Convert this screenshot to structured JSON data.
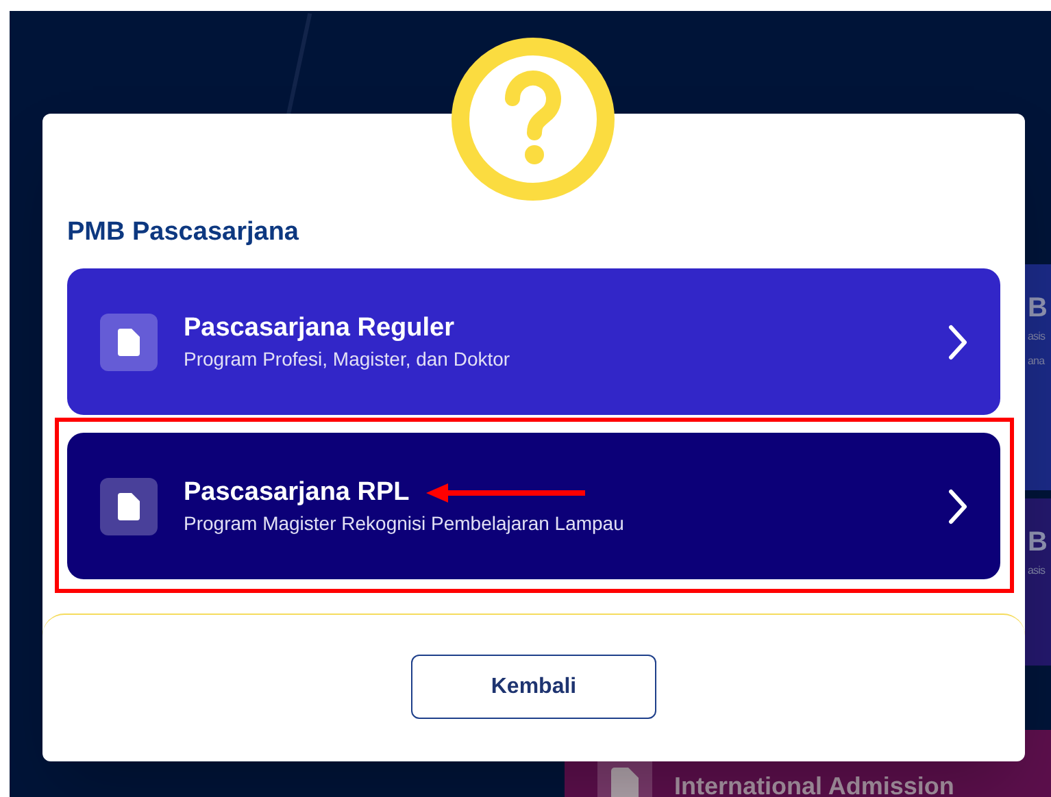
{
  "background": {
    "cards": [
      {
        "kind": "edge",
        "heading": "B",
        "lines": [
          "asis",
          "ana"
        ]
      },
      {
        "kind": "edge",
        "heading": "B",
        "lines": [
          "asis"
        ]
      },
      {
        "kind": "wide",
        "heading": "International Admission"
      }
    ]
  },
  "dialog": {
    "title": "PMB Pascasarjana",
    "options": [
      {
        "title": "Pascasarjana Reguler",
        "subtitle": "Program Profesi, Magister, dan Doktor",
        "hovered": false,
        "highlighted": false
      },
      {
        "title": "Pascasarjana RPL",
        "subtitle": "Program Magister Rekognisi Pembelajaran Lampau",
        "hovered": true,
        "highlighted": true
      }
    ],
    "button": "Kembali"
  }
}
